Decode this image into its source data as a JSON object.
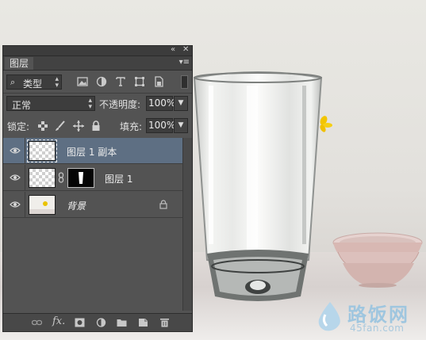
{
  "panel": {
    "collapse_icon": "double-chevron-icon",
    "close_icon": "close-icon",
    "tab_label": "图层",
    "menu_icon": "panel-menu-icon"
  },
  "filter": {
    "search_icon": "search-icon",
    "label": "类型",
    "filter_icons": [
      "image-filter-icon",
      "adjustment-filter-icon",
      "text-filter-icon",
      "shape-filter-icon",
      "smart-object-filter-icon"
    ]
  },
  "blend": {
    "mode": "正常",
    "opacity_label": "不透明度:",
    "opacity_value": "100%"
  },
  "lock": {
    "label": "锁定:",
    "icons": [
      "lock-transparent-icon",
      "lock-pixels-icon",
      "lock-position-icon",
      "lock-all-icon"
    ],
    "fill_label": "填充:",
    "fill_value": "100%"
  },
  "layers": [
    {
      "name": "图层 1 副本",
      "selected": true,
      "visible": true,
      "has_mask": false,
      "locked": false
    },
    {
      "name": "图层 1",
      "selected": false,
      "visible": true,
      "has_mask": true,
      "locked": false
    },
    {
      "name": "背景",
      "selected": false,
      "visible": true,
      "has_mask": false,
      "locked": true
    }
  ],
  "bottom_bar": {
    "icons": [
      "link-layers-icon",
      "fx-icon",
      "add-mask-icon",
      "adjustment-layer-icon",
      "new-group-icon",
      "new-layer-icon",
      "delete-layer-icon"
    ],
    "fx_label": "fx."
  },
  "watermark": {
    "title": "路饭网",
    "subtitle": "45fan.com"
  },
  "colors": {
    "panel_bg": "#535353",
    "selected_row": "#5e6f83",
    "watermark": "#9fc6df"
  }
}
